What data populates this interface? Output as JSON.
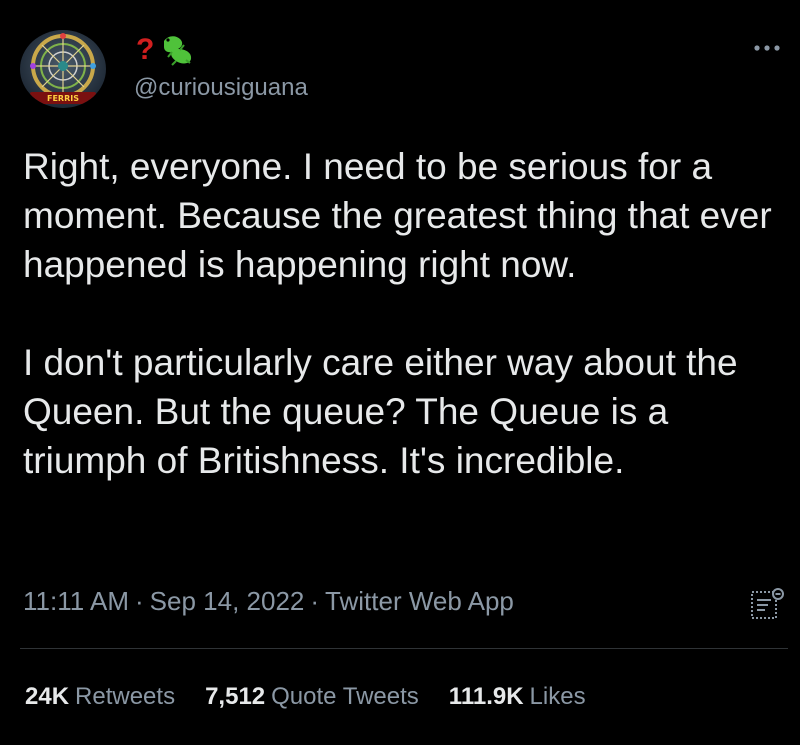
{
  "user": {
    "display_name_emoji": "?",
    "handle": "@curiousiguana",
    "avatar_icon": "ferris-wheel-avatar",
    "name_icon": "lizard-icon"
  },
  "tweet": {
    "paragraphs": [
      "Right, everyone. I need to be serious for a moment. Because the greatest thing that ever happened is happening right now.",
      "I don't particularly care either way about the Queen. But the queue? The Queue is a triumph of Britishness. It's incredible."
    ],
    "time": "11:11 AM",
    "date": "Sep 14, 2022",
    "source": "Twitter Web App",
    "separator": "·"
  },
  "stats": {
    "retweets_count": "24K",
    "retweets_label": "Retweets",
    "quotes_count": "7,512",
    "quotes_label": "Quote Tweets",
    "likes_count": "111.9K",
    "likes_label": "Likes"
  },
  "colors": {
    "background": "#000000",
    "text": "#e7e9ea",
    "secondary": "#8b98a5",
    "divider": "#2f3336",
    "question_mark": "#d11f1f",
    "lizard": "#4fc23a"
  }
}
